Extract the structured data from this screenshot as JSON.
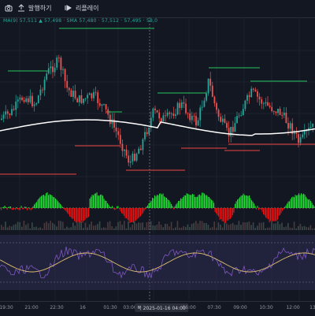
{
  "toolbar": {
    "publish_label": "발행하기",
    "replay_label": "리플레이"
  },
  "indicator_text": "MA(9) 57,511 ▲ 57,498 · SMA 57,480 · 57,512 · 57,495 · 58,0",
  "colors": {
    "background": "#131722",
    "bull": "#26a69a",
    "bear": "#ef5350",
    "level_green": "#22c55e",
    "level_red": "#ef4444",
    "ma_line": "#ffffff",
    "hist_up": "#22dd33",
    "hist_down": "#ee1111",
    "rsi_line": "#7e57c2",
    "rsi_signal": "#e0c070",
    "rsi_band": "#2b2a4e"
  },
  "icons": [
    "camera-icon",
    "publish-icon",
    "replay-icon"
  ],
  "time_axis": {
    "ticks": [
      "19:30",
      "21:00",
      "22:30",
      "16",
      "01:30",
      "03:00",
      "목 2025-01-16  04:00",
      "06:00",
      "07:30",
      "09:00",
      "10:30",
      "12:00",
      "13:"
    ]
  }
}
